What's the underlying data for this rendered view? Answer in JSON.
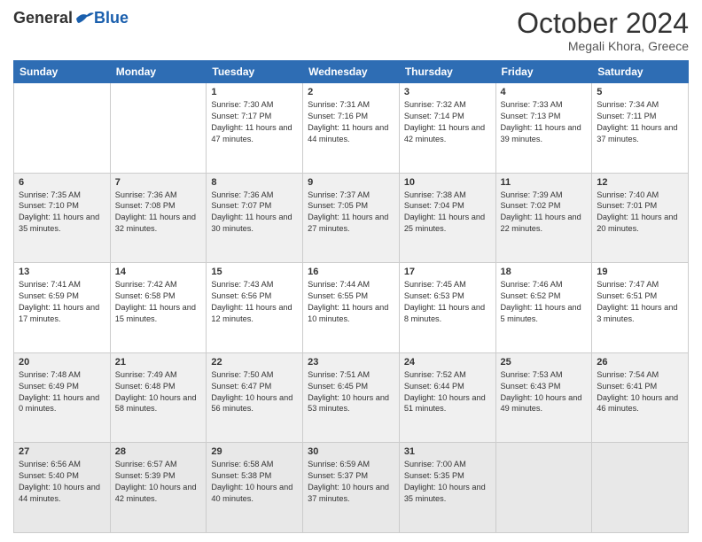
{
  "header": {
    "logo_general": "General",
    "logo_blue": "Blue",
    "month_title": "October 2024",
    "location": "Megali Khora, Greece"
  },
  "columns": [
    "Sunday",
    "Monday",
    "Tuesday",
    "Wednesday",
    "Thursday",
    "Friday",
    "Saturday"
  ],
  "weeks": [
    [
      {
        "day": "",
        "sunrise": "",
        "sunset": "",
        "daylight": ""
      },
      {
        "day": "",
        "sunrise": "",
        "sunset": "",
        "daylight": ""
      },
      {
        "day": "1",
        "sunrise": "Sunrise: 7:30 AM",
        "sunset": "Sunset: 7:17 PM",
        "daylight": "Daylight: 11 hours and 47 minutes."
      },
      {
        "day": "2",
        "sunrise": "Sunrise: 7:31 AM",
        "sunset": "Sunset: 7:16 PM",
        "daylight": "Daylight: 11 hours and 44 minutes."
      },
      {
        "day": "3",
        "sunrise": "Sunrise: 7:32 AM",
        "sunset": "Sunset: 7:14 PM",
        "daylight": "Daylight: 11 hours and 42 minutes."
      },
      {
        "day": "4",
        "sunrise": "Sunrise: 7:33 AM",
        "sunset": "Sunset: 7:13 PM",
        "daylight": "Daylight: 11 hours and 39 minutes."
      },
      {
        "day": "5",
        "sunrise": "Sunrise: 7:34 AM",
        "sunset": "Sunset: 7:11 PM",
        "daylight": "Daylight: 11 hours and 37 minutes."
      }
    ],
    [
      {
        "day": "6",
        "sunrise": "Sunrise: 7:35 AM",
        "sunset": "Sunset: 7:10 PM",
        "daylight": "Daylight: 11 hours and 35 minutes."
      },
      {
        "day": "7",
        "sunrise": "Sunrise: 7:36 AM",
        "sunset": "Sunset: 7:08 PM",
        "daylight": "Daylight: 11 hours and 32 minutes."
      },
      {
        "day": "8",
        "sunrise": "Sunrise: 7:36 AM",
        "sunset": "Sunset: 7:07 PM",
        "daylight": "Daylight: 11 hours and 30 minutes."
      },
      {
        "day": "9",
        "sunrise": "Sunrise: 7:37 AM",
        "sunset": "Sunset: 7:05 PM",
        "daylight": "Daylight: 11 hours and 27 minutes."
      },
      {
        "day": "10",
        "sunrise": "Sunrise: 7:38 AM",
        "sunset": "Sunset: 7:04 PM",
        "daylight": "Daylight: 11 hours and 25 minutes."
      },
      {
        "day": "11",
        "sunrise": "Sunrise: 7:39 AM",
        "sunset": "Sunset: 7:02 PM",
        "daylight": "Daylight: 11 hours and 22 minutes."
      },
      {
        "day": "12",
        "sunrise": "Sunrise: 7:40 AM",
        "sunset": "Sunset: 7:01 PM",
        "daylight": "Daylight: 11 hours and 20 minutes."
      }
    ],
    [
      {
        "day": "13",
        "sunrise": "Sunrise: 7:41 AM",
        "sunset": "Sunset: 6:59 PM",
        "daylight": "Daylight: 11 hours and 17 minutes."
      },
      {
        "day": "14",
        "sunrise": "Sunrise: 7:42 AM",
        "sunset": "Sunset: 6:58 PM",
        "daylight": "Daylight: 11 hours and 15 minutes."
      },
      {
        "day": "15",
        "sunrise": "Sunrise: 7:43 AM",
        "sunset": "Sunset: 6:56 PM",
        "daylight": "Daylight: 11 hours and 12 minutes."
      },
      {
        "day": "16",
        "sunrise": "Sunrise: 7:44 AM",
        "sunset": "Sunset: 6:55 PM",
        "daylight": "Daylight: 11 hours and 10 minutes."
      },
      {
        "day": "17",
        "sunrise": "Sunrise: 7:45 AM",
        "sunset": "Sunset: 6:53 PM",
        "daylight": "Daylight: 11 hours and 8 minutes."
      },
      {
        "day": "18",
        "sunrise": "Sunrise: 7:46 AM",
        "sunset": "Sunset: 6:52 PM",
        "daylight": "Daylight: 11 hours and 5 minutes."
      },
      {
        "day": "19",
        "sunrise": "Sunrise: 7:47 AM",
        "sunset": "Sunset: 6:51 PM",
        "daylight": "Daylight: 11 hours and 3 minutes."
      }
    ],
    [
      {
        "day": "20",
        "sunrise": "Sunrise: 7:48 AM",
        "sunset": "Sunset: 6:49 PM",
        "daylight": "Daylight: 11 hours and 0 minutes."
      },
      {
        "day": "21",
        "sunrise": "Sunrise: 7:49 AM",
        "sunset": "Sunset: 6:48 PM",
        "daylight": "Daylight: 10 hours and 58 minutes."
      },
      {
        "day": "22",
        "sunrise": "Sunrise: 7:50 AM",
        "sunset": "Sunset: 6:47 PM",
        "daylight": "Daylight: 10 hours and 56 minutes."
      },
      {
        "day": "23",
        "sunrise": "Sunrise: 7:51 AM",
        "sunset": "Sunset: 6:45 PM",
        "daylight": "Daylight: 10 hours and 53 minutes."
      },
      {
        "day": "24",
        "sunrise": "Sunrise: 7:52 AM",
        "sunset": "Sunset: 6:44 PM",
        "daylight": "Daylight: 10 hours and 51 minutes."
      },
      {
        "day": "25",
        "sunrise": "Sunrise: 7:53 AM",
        "sunset": "Sunset: 6:43 PM",
        "daylight": "Daylight: 10 hours and 49 minutes."
      },
      {
        "day": "26",
        "sunrise": "Sunrise: 7:54 AM",
        "sunset": "Sunset: 6:41 PM",
        "daylight": "Daylight: 10 hours and 46 minutes."
      }
    ],
    [
      {
        "day": "27",
        "sunrise": "Sunrise: 6:56 AM",
        "sunset": "Sunset: 5:40 PM",
        "daylight": "Daylight: 10 hours and 44 minutes."
      },
      {
        "day": "28",
        "sunrise": "Sunrise: 6:57 AM",
        "sunset": "Sunset: 5:39 PM",
        "daylight": "Daylight: 10 hours and 42 minutes."
      },
      {
        "day": "29",
        "sunrise": "Sunrise: 6:58 AM",
        "sunset": "Sunset: 5:38 PM",
        "daylight": "Daylight: 10 hours and 40 minutes."
      },
      {
        "day": "30",
        "sunrise": "Sunrise: 6:59 AM",
        "sunset": "Sunset: 5:37 PM",
        "daylight": "Daylight: 10 hours and 37 minutes."
      },
      {
        "day": "31",
        "sunrise": "Sunrise: 7:00 AM",
        "sunset": "Sunset: 5:35 PM",
        "daylight": "Daylight: 10 hours and 35 minutes."
      },
      {
        "day": "",
        "sunrise": "",
        "sunset": "",
        "daylight": ""
      },
      {
        "day": "",
        "sunrise": "",
        "sunset": "",
        "daylight": ""
      }
    ]
  ]
}
